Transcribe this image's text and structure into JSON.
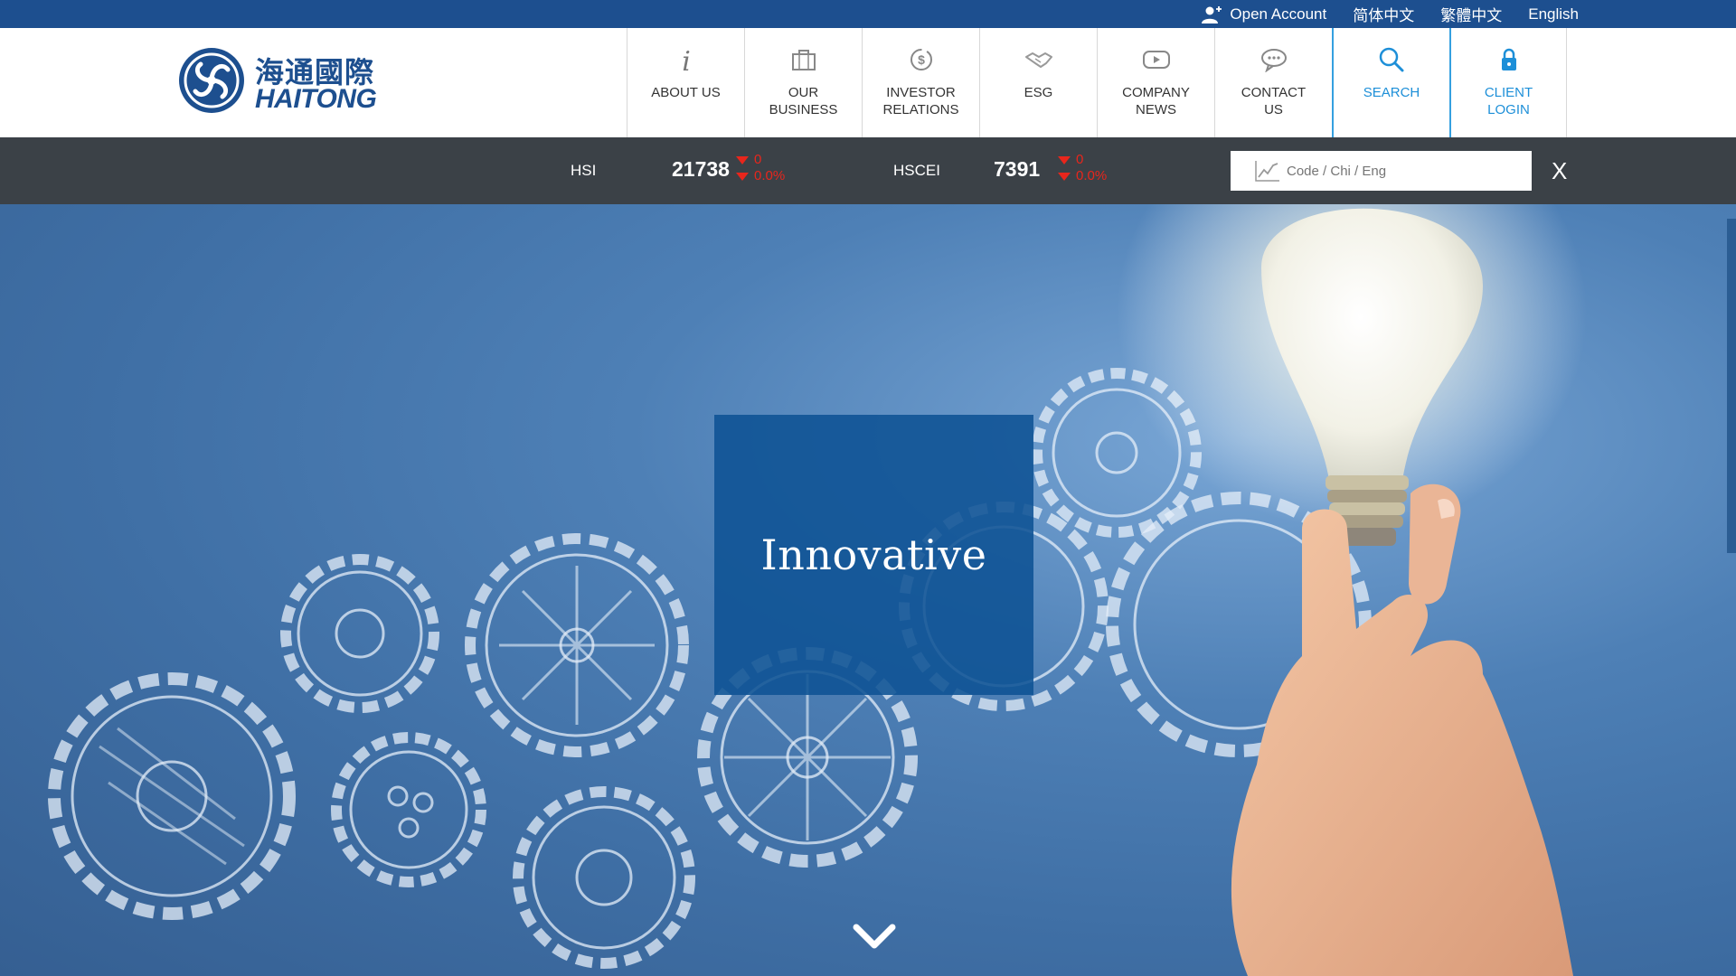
{
  "topbar": {
    "open_account": "Open Account",
    "languages": [
      "简体中文",
      "繁體中文",
      "English"
    ],
    "user_icon": "user-plus-icon"
  },
  "logo": {
    "chinese": "海通國際",
    "english": "HAITONG"
  },
  "nav": [
    {
      "label": "ABOUT US",
      "icon": "info-icon"
    },
    {
      "label": "OUR\nBUSINESS",
      "icon": "briefcase-icon"
    },
    {
      "label": "INVESTOR\nRELATIONS",
      "icon": "dollar-circle-icon"
    },
    {
      "label": "ESG",
      "icon": "handshake-icon"
    },
    {
      "label": "COMPANY\nNEWS",
      "icon": "play-icon"
    },
    {
      "label": "CONTACT\nUS",
      "icon": "chat-icon"
    },
    {
      "label": "SEARCH",
      "icon": "search-icon"
    },
    {
      "label": "CLIENT\nLOGIN",
      "icon": "lock-icon"
    }
  ],
  "ticker": {
    "hsi": {
      "label": "HSI",
      "value": "21738",
      "change": "0",
      "change_pct": "0.0%"
    },
    "hscei": {
      "label": "HSCEI",
      "value": "7391",
      "change": "0",
      "change_pct": "0.0%"
    },
    "search_placeholder": "Code / Chi / Eng",
    "close_label": "X",
    "down_color": "#e8261c"
  },
  "hero": {
    "caption": "Innovative",
    "scroll_icon": "chevron-down-icon"
  },
  "colors": {
    "brand": "#1d4f8f",
    "accent": "#1d8fd8",
    "ticker_bg": "#3b4147"
  }
}
